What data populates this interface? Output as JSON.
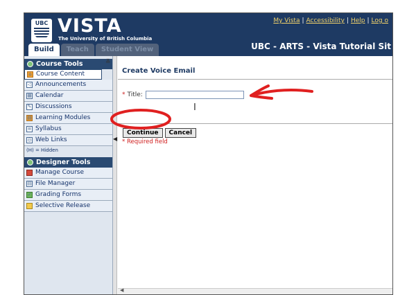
{
  "header": {
    "logo_text": "UBC",
    "app_name": "VISTA",
    "subtitle": "The University of British Columbia",
    "links": [
      "My Vista",
      "Accessibility",
      "Help",
      "Log o"
    ],
    "link_separator": "|",
    "course_title": "UBC - ARTS - Vista Tutorial Sit",
    "tabs": [
      "Build",
      "Teach",
      "Student View"
    ]
  },
  "sidebar": {
    "course_tools": {
      "heading": "Course Tools",
      "items": [
        {
          "label": "Course Content",
          "icon": "home-icon"
        },
        {
          "label": "Announcements",
          "icon": "megaphone-icon"
        },
        {
          "label": "Calendar",
          "icon": "calendar-icon"
        },
        {
          "label": "Discussions",
          "icon": "discussion-icon"
        },
        {
          "label": "Learning Modules",
          "icon": "module-icon"
        },
        {
          "label": "Syllabus",
          "icon": "syllabus-icon"
        },
        {
          "label": "Web Links",
          "icon": "web-link-icon"
        }
      ]
    },
    "hidden_note": "(H) = Hidden",
    "designer_tools": {
      "heading": "Designer Tools",
      "items": [
        {
          "label": "Manage Course",
          "icon": "manage-course-icon"
        },
        {
          "label": "File Manager",
          "icon": "file-manager-icon"
        },
        {
          "label": "Grading Forms",
          "icon": "grading-forms-icon"
        },
        {
          "label": "Selective Release",
          "icon": "selective-release-icon"
        }
      ]
    }
  },
  "main": {
    "title": "Create Voice Email",
    "form": {
      "required_marker": "*",
      "title_label": "Title:",
      "title_value": "",
      "continue_label": "Continue",
      "cancel_label": "Cancel",
      "required_note": "* Required field"
    }
  },
  "colors": {
    "header_bg": "#1e3a63",
    "link_color": "#f3d36a",
    "annotation_red": "#e02020",
    "required_red": "#cc2020"
  }
}
